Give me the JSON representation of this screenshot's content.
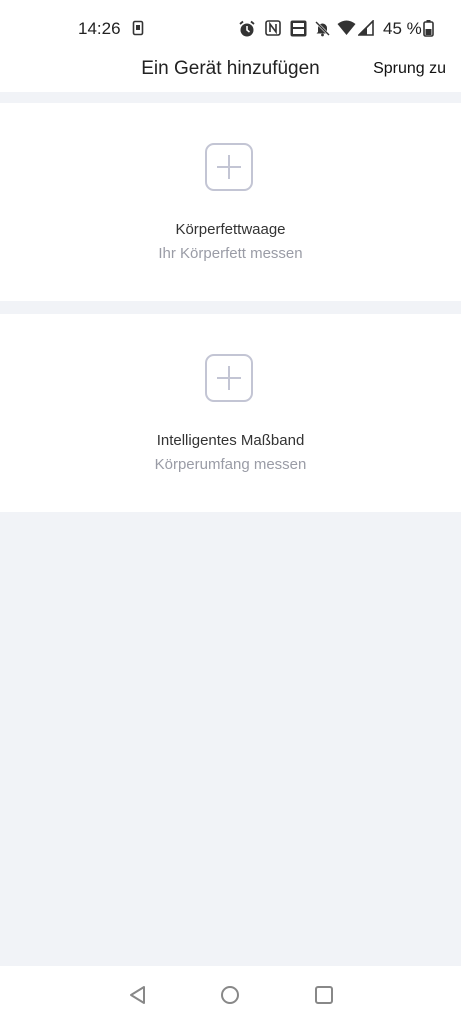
{
  "status_bar": {
    "time": "14:26",
    "battery_percent": "45 %",
    "icons": [
      "sim-icon",
      "alarm-icon",
      "nfc-icon",
      "volte-icon",
      "mute-icon",
      "wifi-icon",
      "signal-icon",
      "battery-icon"
    ]
  },
  "header": {
    "title": "Ein Gerät hinzufügen",
    "action_label": "Sprung zu"
  },
  "devices": [
    {
      "title": "Körperfettwaage",
      "subtitle": "Ihr Körperfett messen",
      "icon": "add-icon"
    },
    {
      "title": "Intelligentes Maßband",
      "subtitle": "Körperumfang messen",
      "icon": "add-icon"
    }
  ],
  "nav_bar": {
    "buttons": [
      "back-icon",
      "home-icon",
      "recents-icon"
    ]
  },
  "colors": {
    "background": "#f1f3f7",
    "card": "#ffffff",
    "plus_border": "#c3c5d4",
    "subtitle": "#9a9ca6"
  }
}
